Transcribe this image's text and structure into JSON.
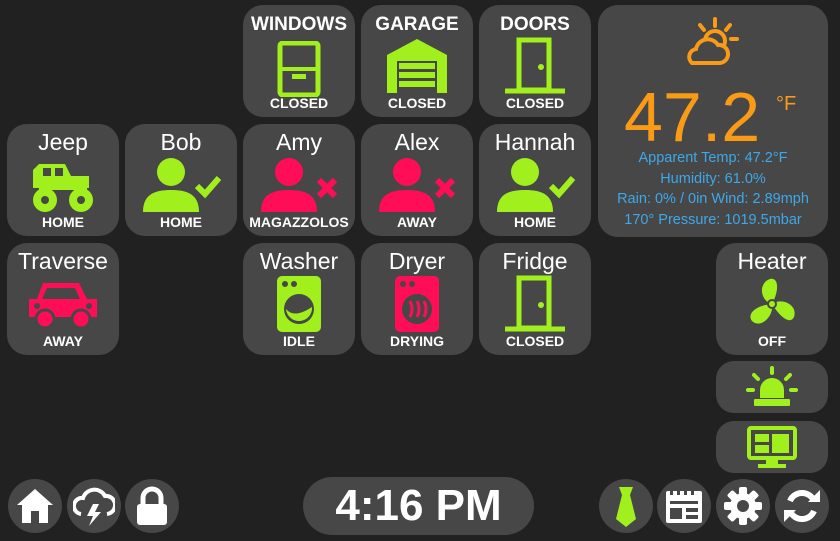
{
  "tiles": {
    "windows": {
      "title": "WINDOWS",
      "state": "CLOSED"
    },
    "garage": {
      "title": "GARAGE",
      "state": "CLOSED"
    },
    "doors": {
      "title": "DOORS",
      "state": "CLOSED"
    },
    "jeep": {
      "title": "Jeep",
      "state": "HOME"
    },
    "bob": {
      "title": "Bob",
      "state": "HOME"
    },
    "amy": {
      "title": "Amy",
      "state": "MAGAZZOLOS"
    },
    "alex": {
      "title": "Alex",
      "state": "AWAY"
    },
    "hannah": {
      "title": "Hannah",
      "state": "HOME"
    },
    "traverse": {
      "title": "Traverse",
      "state": "AWAY"
    },
    "washer": {
      "title": "Washer",
      "state": "IDLE"
    },
    "dryer": {
      "title": "Dryer",
      "state": "DRYING"
    },
    "fridge": {
      "title": "Fridge",
      "state": "CLOSED"
    },
    "heater": {
      "title": "Heater",
      "state": "OFF"
    }
  },
  "weather": {
    "icon": "partly-cloudy-day-icon",
    "temperature": "47.2",
    "unit": "°F",
    "apparent": "Apparent Temp: 47.2°F",
    "humidity": "Humidity: 61.0%",
    "rain_wind": "Rain: 0% / 0in  Wind: 2.89mph",
    "bearing_pressure": "170°  Pressure: 1019.5mbar"
  },
  "clock": {
    "time": "4:16 PM"
  },
  "colors": {
    "ok": "#a1f01e",
    "alert": "#ff0d57",
    "accent": "#f99b16",
    "info": "#3da8ea",
    "tile": "#474747",
    "background": "#212121"
  },
  "bottom_buttons": [
    "home-icon",
    "weather-storm-icon",
    "lock-icon",
    "tie-icon",
    "calendar-icon",
    "gear-icon",
    "refresh-icon"
  ],
  "side_buttons": [
    "alarm-light-icon",
    "monitor-dashboard-icon"
  ]
}
